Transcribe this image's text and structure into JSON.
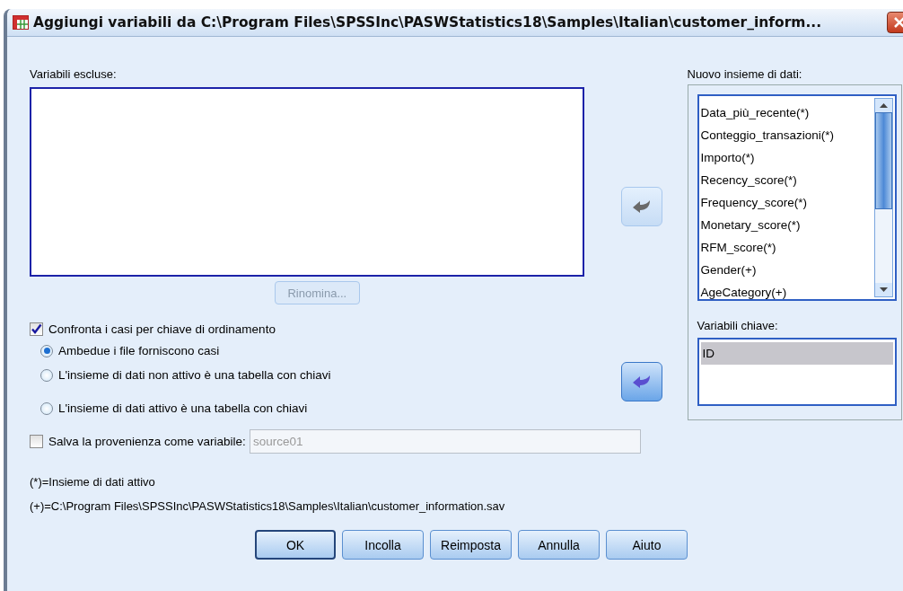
{
  "window": {
    "title": "Aggiungi variabili da C:\\Program Files\\SPSSInc\\PASWStatistics18\\Samples\\Italian\\customer_inform..."
  },
  "excluded": {
    "label": "Variabili escluse:",
    "rename_button": {
      "label": "Rinomina...",
      "disabled": true
    }
  },
  "match_cases": {
    "label": "Confronta i casi per chiave di ordinamento",
    "checked": true
  },
  "radio_options": [
    {
      "label": "Ambedue i file forniscono casi",
      "selected": true
    },
    {
      "label": "L'insieme di dati non attivo è una tabella con chiavi",
      "selected": false
    },
    {
      "label": "L'insieme di dati attivo è una tabella con chiavi",
      "selected": false
    }
  ],
  "save_source": {
    "label": "Salva la provenienza come variabile:",
    "checked": false,
    "value": "source01",
    "disabled": true
  },
  "legend": [
    "(*)=Insieme di dati attivo",
    "(+)=C:\\Program Files\\SPSSInc\\PASWStatistics18\\Samples\\Italian\\customer_information.sav"
  ],
  "new_dataset": {
    "label": "Nuovo insieme di dati:",
    "move_button": {
      "disabled": true
    },
    "items": [
      {
        "label": "Data_più_recente(*)",
        "selected": false
      },
      {
        "label": "Conteggio_transazioni(*)",
        "selected": false
      },
      {
        "label": "Importo(*)",
        "selected": false
      },
      {
        "label": "Recency_score(*)",
        "selected": false
      },
      {
        "label": "Frequency_score(*)",
        "selected": false
      },
      {
        "label": "Monetary_score(*)",
        "selected": false
      },
      {
        "label": "RFM_score(*)",
        "selected": false
      },
      {
        "label": "Gender(+)",
        "selected": false
      },
      {
        "label": "AgeCategory(+)",
        "selected": false
      }
    ]
  },
  "key_variables": {
    "label": "Variabili chiave:",
    "move_button": {
      "disabled": false
    },
    "items": [
      {
        "label": "ID",
        "selected": true
      }
    ]
  },
  "buttons": [
    {
      "label": "OK",
      "default": true
    },
    {
      "label": "Incolla",
      "default": false
    },
    {
      "label": "Reimposta",
      "default": false
    },
    {
      "label": "Annulla",
      "default": false
    },
    {
      "label": "Aiuto",
      "default": false
    }
  ]
}
